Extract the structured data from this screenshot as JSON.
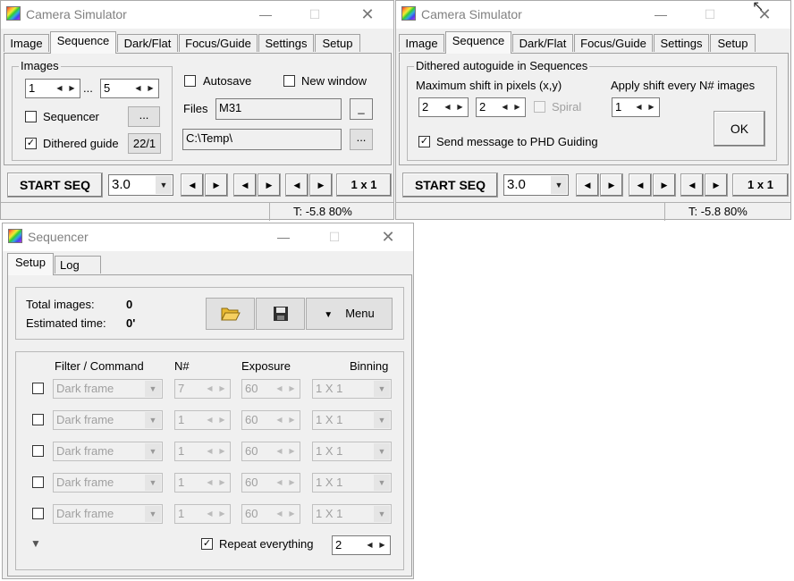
{
  "window1": {
    "title": "Camera Simulator",
    "tabs": [
      "Image",
      "Sequence",
      "Dark/Flat",
      "Focus/Guide",
      "Settings",
      "Setup"
    ],
    "images_group": "Images",
    "from_value": "1",
    "range_sep": "...",
    "to_value": "5",
    "sequencer_label": "Sequencer",
    "sequencer_button": "...",
    "dithered_label": "Dithered guide",
    "dithered_button": "22/1",
    "autosave_label": "Autosave",
    "new_window_label": "New window",
    "files_label": "Files",
    "files_value": "M31",
    "files_button": "_",
    "path_value": "C:\\Temp\\",
    "path_button": "...",
    "start_button": "START SEQ",
    "exposure_value": "3.0",
    "binning_button": "1 x 1",
    "status_temp": "T: -5.8  80%"
  },
  "window2": {
    "title": "Camera Simulator",
    "tabs": [
      "Image",
      "Sequence",
      "Dark/Flat",
      "Focus/Guide",
      "Settings",
      "Setup"
    ],
    "group_label": "Dithered autoguide in Sequences",
    "max_shift_label": "Maximum shift in pixels (x,y)",
    "shift_x": "2",
    "shift_y": "2",
    "spiral_label": "Spiral",
    "apply_shift_label": "Apply shift every N# images",
    "apply_value": "1",
    "send_message_label": "Send message to PHD Guiding",
    "ok_button": "OK",
    "start_button": "START SEQ",
    "exposure_value": "3.0",
    "binning_button": "1 x 1",
    "status_temp": "T: -5.8  80%"
  },
  "window3": {
    "title": "Sequencer",
    "tabs": [
      "Setup",
      "Log"
    ],
    "total_images_label": "Total images:",
    "total_images_value": "0",
    "estimated_time_label": "Estimated time:",
    "estimated_time_value": "0'",
    "menu_button": "Menu",
    "headers": {
      "filter": "Filter / Command",
      "n": "N#",
      "exposure": "Exposure",
      "binning": "Binning"
    },
    "rows": [
      {
        "filter": "Dark frame",
        "n": "7",
        "exposure": "60",
        "binning": "1 X 1"
      },
      {
        "filter": "Dark frame",
        "n": "1",
        "exposure": "60",
        "binning": "1 X 1"
      },
      {
        "filter": "Dark frame",
        "n": "1",
        "exposure": "60",
        "binning": "1 X 1"
      },
      {
        "filter": "Dark frame",
        "n": "1",
        "exposure": "60",
        "binning": "1 X 1"
      },
      {
        "filter": "Dark frame",
        "n": "1",
        "exposure": "60",
        "binning": "1 X 1"
      }
    ],
    "repeat_label": "Repeat everything",
    "repeat_value": "2"
  }
}
